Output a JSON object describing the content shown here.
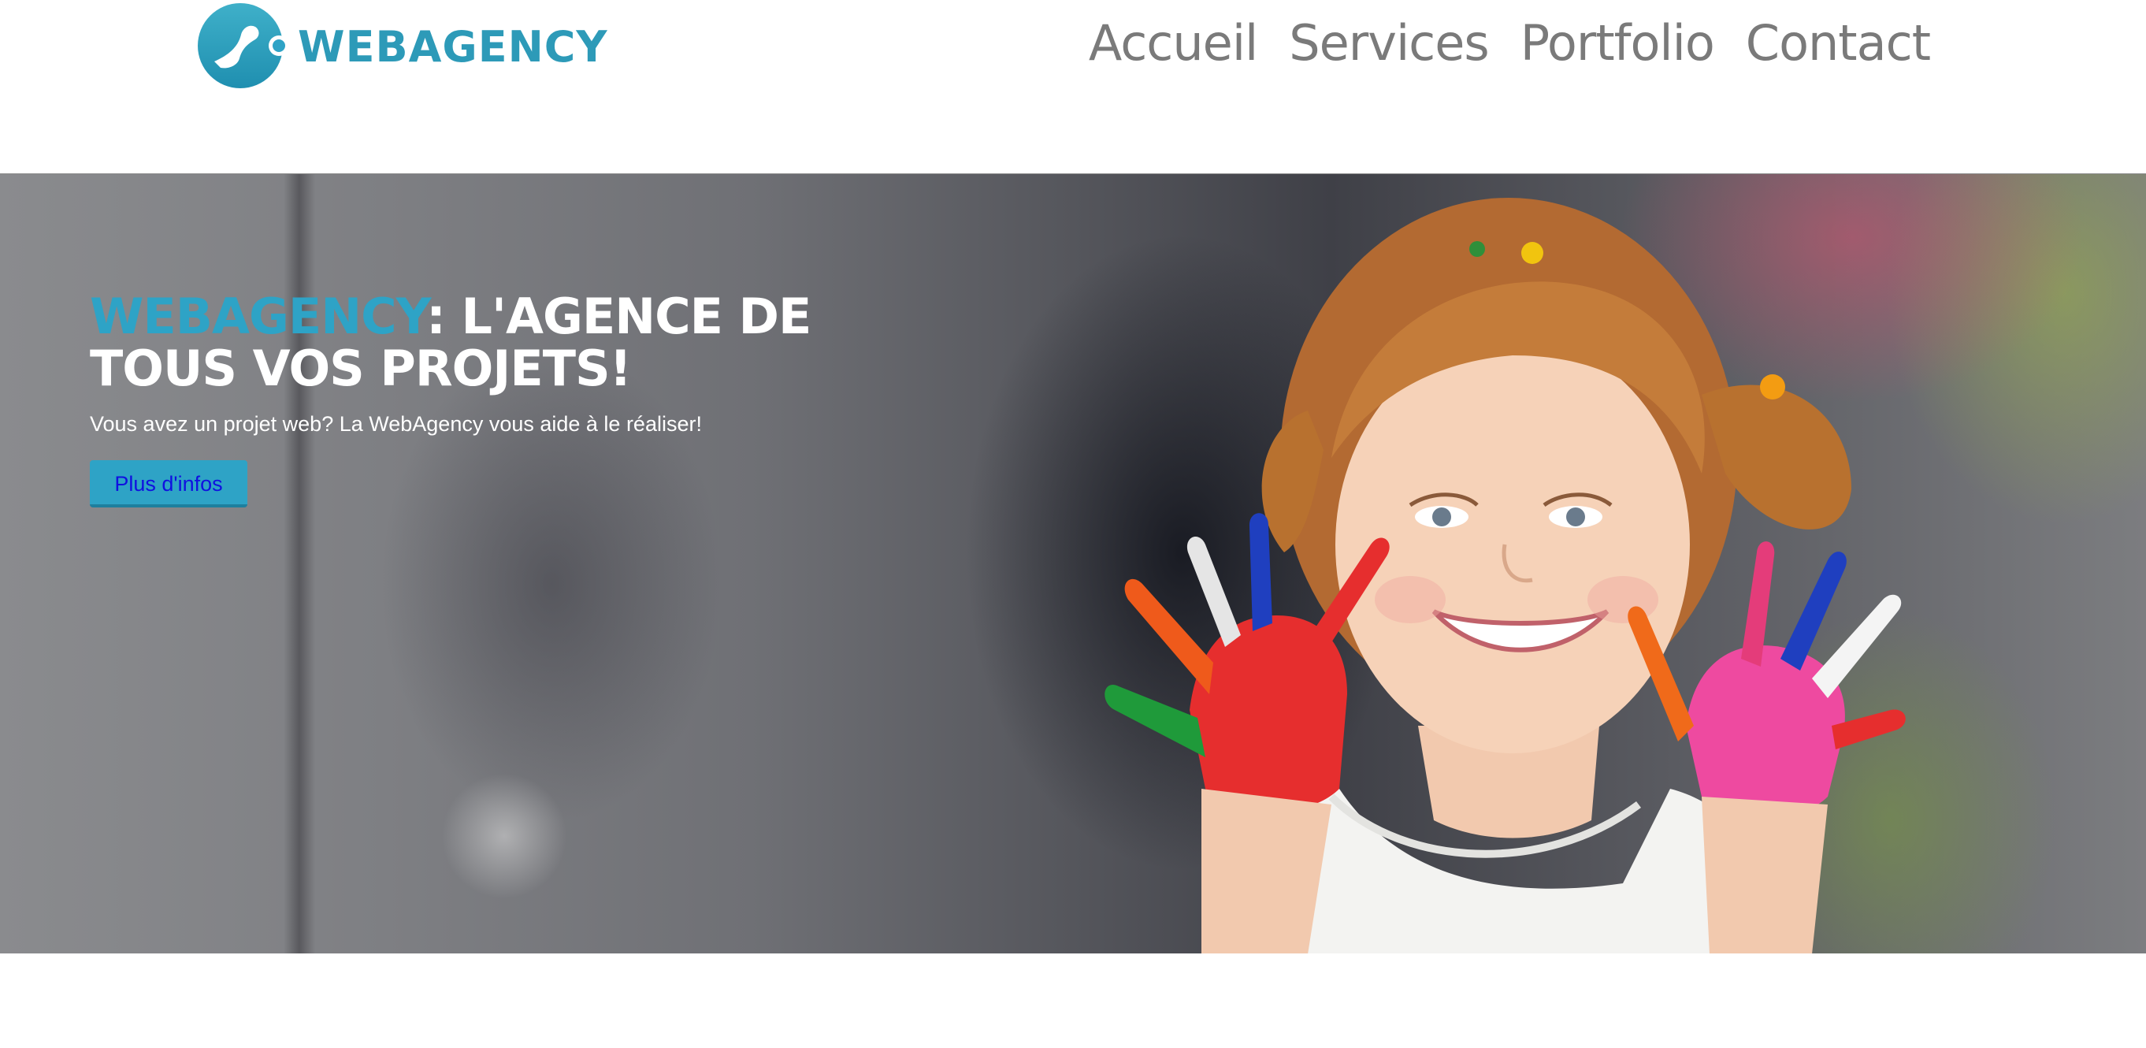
{
  "header": {
    "logo_text": "WEBAGENCY",
    "nav": [
      {
        "label": "Accueil"
      },
      {
        "label": "Services"
      },
      {
        "label": "Portfolio"
      },
      {
        "label": "Contact"
      }
    ]
  },
  "hero": {
    "title_brand": "WEBAGENCY",
    "title_rest": ": L'AGENCE DE TOUS VOS PROJETS!",
    "subtitle": "Vous avez un projet web? La WebAgency vous aide à le réaliser!",
    "button_label": "Plus d'infos",
    "image_subject": "smiling-girl-with-painted-hands"
  },
  "colors": {
    "brand": "#2ea3c6",
    "nav_text": "#7a7a7a",
    "button_text": "#1010e0",
    "hero_text": "#ffffff"
  }
}
